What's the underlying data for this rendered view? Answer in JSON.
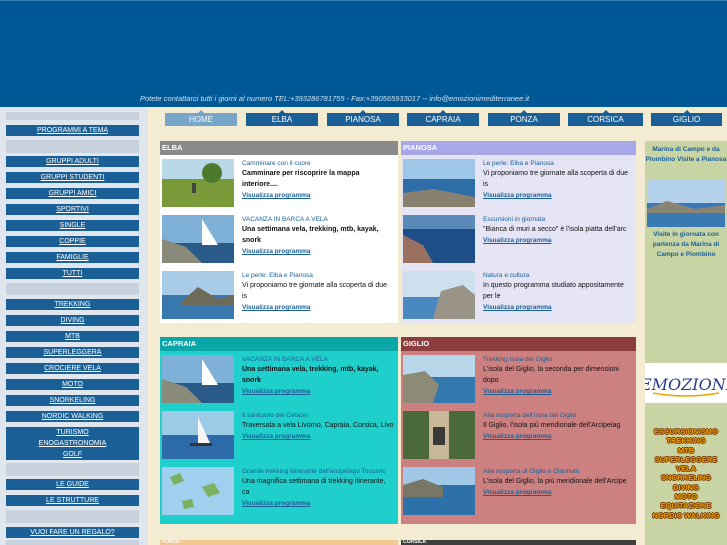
{
  "header": {
    "contact": "Potete contattarci tutti i giorni al numero TEL:+393286781755 - Fax:+390565933017 -- info@emozionimediterranee.it"
  },
  "sidebar": {
    "items": [
      "PROGRAMMI A TEMA",
      "GRUPPI ADULTI",
      "GRUPPI STUDENTI",
      "GRUPPI AMICI",
      "SPORTIVI",
      "SINGLE",
      "COPPIE",
      "FAMIGLIE",
      "TUTTI",
      "TREKKING",
      "DIVING",
      "MTB",
      "SUPERLEGGERA",
      "CROCIERE VELA",
      "MOTO",
      "SNORKELING",
      "NORDIC WALKING",
      "TURISMO",
      "ENOGASTRONOMIA",
      "GOLF",
      "LE GUIDE",
      "LE STRUTTURE",
      "VUOI FARE UN REGALO?"
    ]
  },
  "tabs": [
    "HOME",
    "ELBA",
    "PIANOSA",
    "CAPRAIA",
    "PONZA",
    "CORSICA",
    "GIGLIO"
  ],
  "panels": {
    "elba": {
      "title": "ELBA",
      "items": [
        {
          "title": "Camminare con il cuore",
          "body": "Camminare per riscoprire la mappa interiore....",
          "link": "Visualizza programma"
        },
        {
          "title": "VACANZA IN BARCA A VELA",
          "body": "Una settimana vela, trekking, mtb, kayak, snork",
          "link": "Visualizza programma"
        },
        {
          "title": "Le perle: Elba e Pianosa",
          "body": "Vi proponiamo tre giornate alla scoperta di due is",
          "link": "Visualizza programma"
        }
      ]
    },
    "pianosa": {
      "title": "PIANOSA",
      "items": [
        {
          "title": "Le perle: Elba e Pianosa",
          "body": "Vi proponiamo tre giornate alla scoperta di due is",
          "link": "Visualizza programma"
        },
        {
          "title": "Escursioni in giornata",
          "body": "\"Bianca di muri a secco\" è l'isola piatta dell'arc",
          "link": "Visualizza programma"
        },
        {
          "title": "Natura e cultura",
          "body": "In questo programma studiato appositamente per le",
          "link": "Visualizza programma"
        }
      ]
    },
    "capraia": {
      "title": "CAPRAIA",
      "items": [
        {
          "title": "VACANZA IN BARCA A VELA",
          "body": "Una settimana vela, trekking, mtb, kayak, snork",
          "link": "Visualizza programma"
        },
        {
          "title": "Il santuario dei Cetacei",
          "body": "Traversata a vela Livorno, Capraia, Corsica, Livo",
          "link": "Visualizza programma"
        },
        {
          "title": "Grande trekking itinerante dell'arcipelago Toscano",
          "body": "Una magnifica settimana di trekking itinerante, ca",
          "link": "Visualizza programma"
        }
      ]
    },
    "giglio": {
      "title": "GIGLIO",
      "items": [
        {
          "title": "Trekking Isola del Giglio",
          "body": "L'isola del Giglio, la seconda per dimensioni dopo",
          "link": "Visualizza programma"
        },
        {
          "title": "Alla scoperta dell'Isola del Giglio",
          "body": "Il Giglio, l'isola più meridionale dell'Arcipelag",
          "link": "Visualizza programma"
        },
        {
          "title": "Alla scoperta di Giglio e Giannutri",
          "body": "L'isola del Giglio, la più meridionale dell'Arcipe",
          "link": "Visualizza programma"
        }
      ]
    },
    "bottom": {
      "left": "PONZA",
      "right": "CORSICA"
    }
  },
  "rightbar": {
    "top": "Marina di Campo e da Piombino Visite a Pianosa",
    "middle": "Visite in giornata con partenza da Marina di Campo e Piombino",
    "logo": "EMOZIONI",
    "activities": [
      "ESCURSIONISMO",
      "TREKKING",
      "MTB",
      "SUPERLEGGERE",
      "VELA",
      "SNORKELING",
      "DIVING",
      "MOTO",
      "EQUITAZIONE",
      "NORDIC WALKING"
    ]
  },
  "colors": {
    "banner": "#005897",
    "nav": "#1a5f96",
    "elba": "#ffffff",
    "pianosa": "#e4e4f5",
    "capraia": "#1fcfcc",
    "giglio": "#cd8080"
  }
}
